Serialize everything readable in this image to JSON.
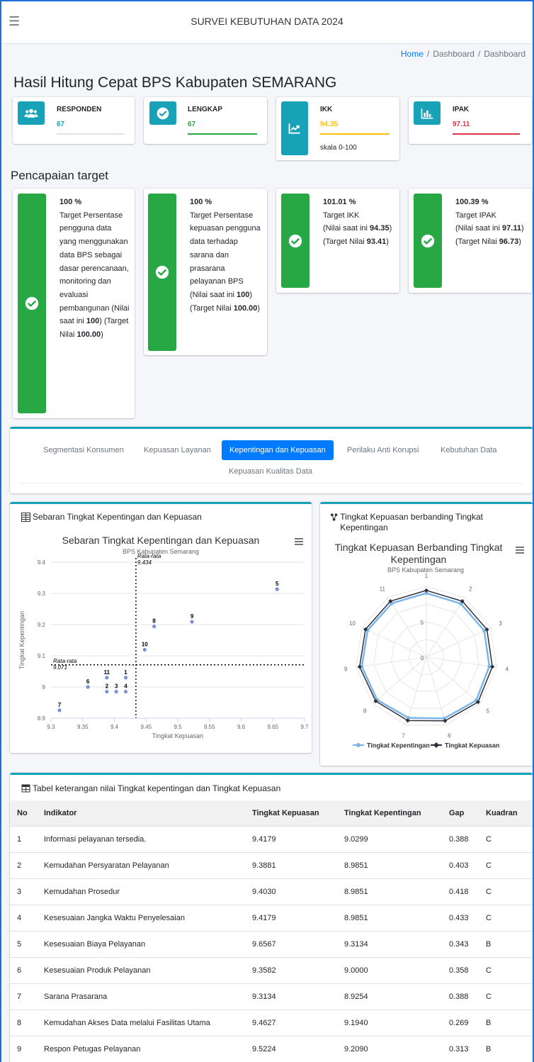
{
  "app": {
    "title": "SURVEI KEBUTUHAN DATA 2024"
  },
  "breadcrumb": [
    "Home",
    "Dashboard",
    "Dashboard"
  ],
  "page_title": "Hasil Hitung Cepat BPS Kabupaten SEMARANG",
  "info_boxes": [
    {
      "label": "RESPONDEN",
      "value": "67",
      "value_color": "#17a2b8",
      "bar_color": "#dee2e6",
      "icon": "users-icon"
    },
    {
      "label": "LENGKAP",
      "value": "67",
      "value_color": "#28a745",
      "bar_color": "#28a745",
      "icon": "check-circle-icon"
    },
    {
      "label": "IKK",
      "value": "94.35",
      "value_color": "#ffc107",
      "bar_color": "#ffc107",
      "note": "skala 0-100",
      "icon": "line-chart-icon"
    },
    {
      "label": "IPAK",
      "value": "97.11",
      "value_color": "#dc3545",
      "bar_color": "#dc3545",
      "icon": "bar-chart-icon"
    }
  ],
  "target_heading": "Pencapaian target",
  "targets": [
    {
      "pct": "100 %",
      "desc": "Target Persentase pengguna data yang menggunakan data BPS sebagai dasar perencanaan, monitoring dan evaluasi pembangunan",
      "current_prefix": "(Nilai saat ini ",
      "current": "100",
      "current_suffix": ")",
      "target_prefix": "(Target Nilai ",
      "target": "100.00",
      "target_suffix": ")"
    },
    {
      "pct": "100 %",
      "desc": "Target Persentase kepuasan pengguna data terhadap sarana dan prasarana pelayanan BPS",
      "current_prefix": "(Nilai saat ini ",
      "current": "100",
      "current_suffix": ")",
      "target_prefix": "(Target Nilai ",
      "target": "100.00",
      "target_suffix": ")"
    },
    {
      "pct": "101.01 %",
      "desc": "Target IKK",
      "current_prefix": "(Nilai saat ini ",
      "current": "94.35",
      "current_suffix": ")",
      "target_prefix": "(Target Nilai ",
      "target": "93.41",
      "target_suffix": ")"
    },
    {
      "pct": "100.39 %",
      "desc": "Target IPAK",
      "current_prefix": "(Nilai saat ini ",
      "current": "97.11",
      "current_suffix": ")",
      "target_prefix": "(Target Nilai ",
      "target": "96.73",
      "target_suffix": ")"
    }
  ],
  "tabs": [
    "Segmentasi Konsumen",
    "Kepuasan Layanan",
    "Kepentingan dan Kepuasan",
    "Perilaku Anti Korupsi",
    "Kebutuhan Data",
    "Kepuasan Kualitas Data"
  ],
  "active_tab": "Kepentingan dan Kepuasan",
  "scatter_card_title": "Sebaran Tingkat Kepentingan dan Kepuasan",
  "radar_card_title": "Tingkat Kepuasan berbanding Tingkat Kepentingan",
  "table_card_title": "Tabel keterangan nilai Tingkat kepentingan dan Tingkat Kepuasan",
  "chart_data": [
    {
      "type": "scatter",
      "title": "Sebaran Tingkat Kepentingan dan Kepuasan",
      "subtitle": "BPS Kabupaten Semarang",
      "xlabel": "Tingkat Kepuasan",
      "ylabel": "Tingkat Kepentingan",
      "xlim": [
        9.3,
        9.7
      ],
      "ylim": [
        8.9,
        9.4
      ],
      "xticks": [
        "9.3",
        "9.35",
        "9.4",
        "9.45",
        "9.5",
        "9.55",
        "9.6",
        "9.65",
        "9.7"
      ],
      "yticks": [
        "8.9",
        "9",
        "9.1",
        "9.2",
        "9.3",
        "9.4"
      ],
      "grid": true,
      "color": "#7b8fd8",
      "points": [
        {
          "label": "1",
          "x": 9.4179,
          "y": 9.0299
        },
        {
          "label": "2",
          "x": 9.3881,
          "y": 8.9851
        },
        {
          "label": "3",
          "x": 9.403,
          "y": 8.9851
        },
        {
          "label": "4",
          "x": 9.4179,
          "y": 8.9851
        },
        {
          "label": "5",
          "x": 9.6567,
          "y": 9.3134
        },
        {
          "label": "6",
          "x": 9.3582,
          "y": 9.0
        },
        {
          "label": "7",
          "x": 9.3134,
          "y": 8.9254
        },
        {
          "label": "8",
          "x": 9.4627,
          "y": 9.194
        },
        {
          "label": "9",
          "x": 9.5224,
          "y": 9.209
        },
        {
          "label": "10",
          "x": 9.4478,
          "y": 9.1194
        },
        {
          "label": "11",
          "x": 9.3881,
          "y": 9.0299
        }
      ],
      "ref_lines": [
        {
          "axis": "x",
          "value": 9.434,
          "label_top": "Rata-rata",
          "label_bottom": "9.434"
        },
        {
          "axis": "y",
          "value": 9.071,
          "label_top": "Rata-rata",
          "label_bottom": "9.071"
        }
      ]
    },
    {
      "type": "radar",
      "title": "Tingkat Kepuasan Berbanding Tingkat Kepentingan",
      "subtitle": "BPS Kabupaten Semarang",
      "categories": [
        "1",
        "2",
        "3",
        "4",
        "5",
        "6",
        "7",
        "8",
        "9",
        "10",
        "11"
      ],
      "radial_ticks": [
        "0",
        "5"
      ],
      "rlim": [
        0,
        10
      ],
      "legend": "bottom",
      "series": [
        {
          "name": "Tingkat Kepentingan",
          "color": "#7cb5ec",
          "values": [
            9.0299,
            8.9851,
            8.9851,
            8.9851,
            9.3134,
            9.0,
            8.9254,
            9.194,
            9.209,
            9.1194,
            9.0299
          ]
        },
        {
          "name": "Tingkat Kepuasan",
          "color": "#2b2f3a",
          "values": [
            9.4179,
            9.3881,
            9.403,
            9.4179,
            9.6567,
            9.3582,
            9.3134,
            9.4627,
            9.5224,
            9.4478,
            9.3881
          ]
        }
      ]
    }
  ],
  "table": {
    "headers": [
      "No",
      "Indikator",
      "Tingkat Kepuasan",
      "Tingkat Kepentingan",
      "Gap",
      "Kuadran"
    ],
    "rows": [
      [
        "1",
        "Informasi pelayanan tersedia.",
        "9.4179",
        "9.0299",
        "0.388",
        "C"
      ],
      [
        "2",
        "Kemudahan Persyaratan Pelayanan",
        "9.3881",
        "8.9851",
        "0.403",
        "C"
      ],
      [
        "3",
        "Kemudahan Prosedur",
        "9.4030",
        "8.9851",
        "0.418",
        "C"
      ],
      [
        "4",
        "Kesesuaian Jangka Waktu Penyelesaian",
        "9.4179",
        "8.9851",
        "0.433",
        "C"
      ],
      [
        "5",
        "Kesesuaian Biaya Pelayanan",
        "9.6567",
        "9.3134",
        "0.343",
        "B"
      ],
      [
        "6",
        "Kesesuaian Produk Pelayanan",
        "9.3582",
        "9.0000",
        "0.358",
        "C"
      ],
      [
        "7",
        "Sarana Prasarana",
        "9.3134",
        "8.9254",
        "0.388",
        "C"
      ],
      [
        "8",
        "Kemudahan Akses Data melalui Fasilitas Utama",
        "9.4627",
        "9.1940",
        "0.269",
        "B"
      ],
      [
        "9",
        "Respon Petugas Pelayanan",
        "9.5224",
        "9.2090",
        "0.313",
        "B"
      ]
    ]
  }
}
